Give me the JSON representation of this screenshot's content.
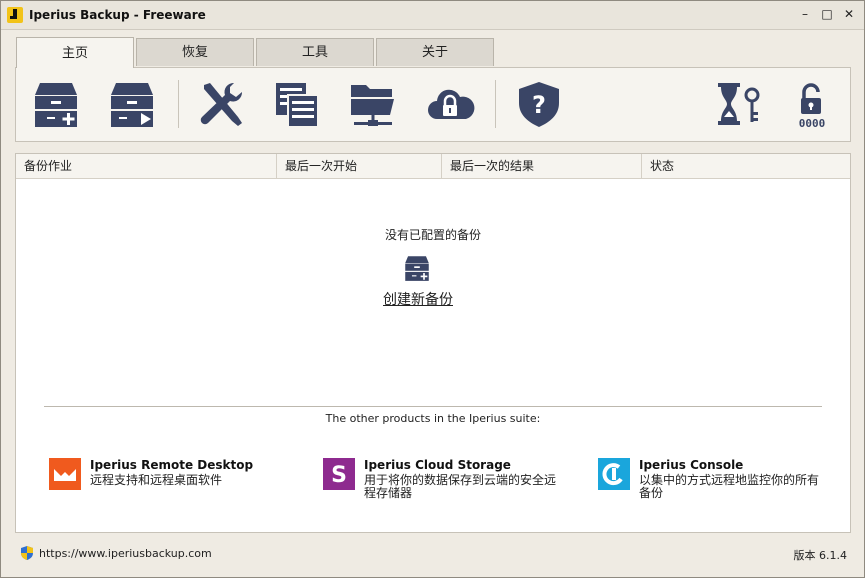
{
  "window": {
    "title": "Iperius Backup - Freeware",
    "controls": {
      "minimize": "–",
      "maximize": "□",
      "close": "✕"
    }
  },
  "tabs": [
    {
      "label": "主页",
      "active": true
    },
    {
      "label": "恢复",
      "active": false
    },
    {
      "label": "工具",
      "active": false
    },
    {
      "label": "关于",
      "active": false
    }
  ],
  "toolbar": {
    "buttons": [
      {
        "icon": "new-backup-icon"
      },
      {
        "icon": "run-backup-icon"
      },
      {
        "icon": "tools-icon"
      },
      {
        "icon": "logs-icon"
      },
      {
        "icon": "network-folder-icon"
      },
      {
        "icon": "cloud-lock-icon"
      },
      {
        "icon": "help-shield-icon"
      },
      {
        "icon": "hourglass-key-icon"
      },
      {
        "icon": "unlock-code-icon"
      }
    ],
    "unlock_code_text": "0000"
  },
  "jobs_table": {
    "columns": [
      "备份作业",
      "最后一次开始",
      "最后一次的结果",
      "状态"
    ],
    "rows": [],
    "empty_message": "没有已配置的备份",
    "create_link": "创建新备份"
  },
  "suite": {
    "caption": "The other products in the Iperius suite:",
    "products": [
      {
        "name": "Iperius Remote Desktop",
        "desc": "远程支持和远程桌面软件",
        "color": "#f05a1e"
      },
      {
        "name": "Iperius Cloud Storage",
        "desc": "用于将你的数据保存到云端的安全远程存储器",
        "color": "#8e2a8f"
      },
      {
        "name": "Iperius Console",
        "desc": "以集中的方式远程地监控你的所有备份",
        "color": "#1aa6dc"
      }
    ]
  },
  "status": {
    "url": "https://www.iperiusbackup.com",
    "version": "版本 6.1.4"
  },
  "colors": {
    "icon_navy": "#3a4566",
    "window_bg": "#efebe3"
  }
}
